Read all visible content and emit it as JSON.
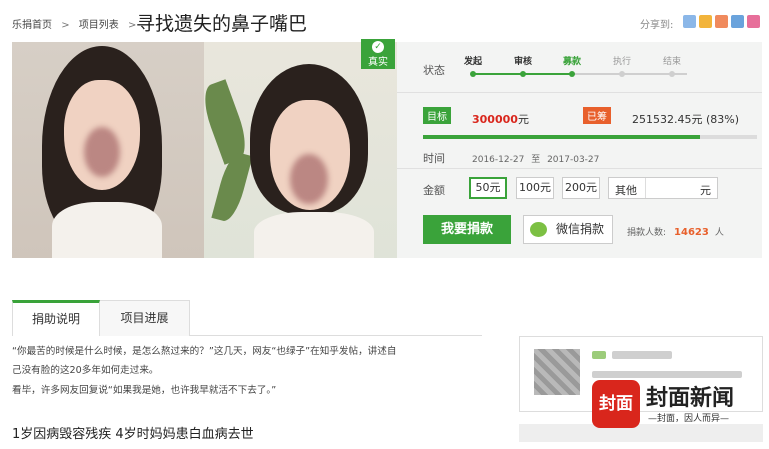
{
  "breadcrumb": {
    "home": "乐捐首页",
    "list": "项目列表",
    "sep1": ">",
    "sep2": ">"
  },
  "title": "寻找遗失的鼻子嘴巴",
  "share": {
    "label": "分享到:",
    "icons": [
      "weibo-icon",
      "qzone-icon",
      "qq-icon",
      "renren-icon",
      "more-icon"
    ]
  },
  "verified": {
    "label": "真实"
  },
  "status": {
    "label": "状态",
    "steps": [
      {
        "label": "发起",
        "state": "done"
      },
      {
        "label": "审核",
        "state": "done"
      },
      {
        "label": "募款",
        "state": "current"
      },
      {
        "label": "执行",
        "state": "todo"
      },
      {
        "label": "结束",
        "state": "todo"
      }
    ]
  },
  "goal": {
    "tag": "目标",
    "amount": "300000",
    "unit": "元"
  },
  "raised": {
    "tag": "已筹",
    "amount": "251532.45元 (83%)",
    "percent": 83
  },
  "time": {
    "label": "时间",
    "start": "2016-12-27",
    "to": "至",
    "end": "2017-03-27"
  },
  "amount": {
    "label": "金额",
    "options": [
      "50元",
      "100元",
      "200元"
    ],
    "selected": "50元",
    "other_label": "其他",
    "other_unit": "元",
    "other_value": ""
  },
  "actions": {
    "donate": "我要捐款",
    "wechat": "微信捐款"
  },
  "donors": {
    "label": "捐款人数:",
    "count": "14623",
    "unit": "人"
  },
  "tabs": [
    {
      "label": "捐助说明"
    },
    {
      "label": "项目进展"
    }
  ],
  "content": {
    "line1": "“你最苦的时候是什么时候，是怎么熬过来的？”这几天，网友“也绿子”在知乎发帖，讲述自",
    "line2": "己没有脸的这20多年如何走过来。",
    "line3": "看毕，许多网友回复说“如果我是她，也许我早就活不下去了。”",
    "section_title": "1岁因病毁容残疾  4岁时妈妈患白血病去世"
  },
  "watermark": {
    "logo": "封面",
    "name": "封面新闻",
    "slogan": "—封面，因人而异—"
  },
  "colors": {
    "accent": "#3aa33a",
    "highlight": "#d9261c",
    "orange": "#e8602c"
  }
}
